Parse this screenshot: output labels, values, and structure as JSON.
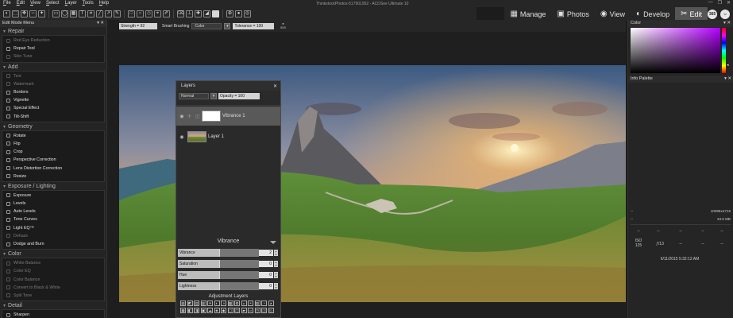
{
  "window": {
    "title": "ThinkstockPhotos-517901952 - ACDSee Ultimate 10",
    "buttons": [
      "—",
      "❐",
      "✕"
    ]
  },
  "menu": [
    "File",
    "Edit",
    "View",
    "Select",
    "Layer",
    "Tools",
    "Help"
  ],
  "toolbar": {
    "icons": [
      "mask-icon",
      "select-icon",
      "move-icon",
      "lasso-icon",
      "magic-wand-icon",
      "rect-select-icon",
      "ellipse-select-icon",
      "brush-select-icon",
      "text-icon",
      "crop-icon",
      "line-icon",
      "arrow-icon",
      "pen-icon",
      "rectangle-icon",
      "circle-icon",
      "shape-icon",
      "dropper-icon",
      "brush-icon",
      "eraser-icon",
      "stamp-icon",
      "heal-icon",
      "fill-icon",
      "gradient-icon",
      "color-swatch-icon",
      "zoom-icon",
      "hand-icon",
      "rotate-icon"
    ]
  },
  "modes": {
    "items": [
      {
        "name": "Manage",
        "icon": "▦"
      },
      {
        "name": "Photos",
        "icon": "▣"
      },
      {
        "name": "View",
        "icon": "◉"
      },
      {
        "name": "Develop",
        "icon": "◐"
      },
      {
        "name": "Edit",
        "icon": "✂"
      }
    ],
    "active": "Edit",
    "round_buttons": [
      "365",
      "☺"
    ]
  },
  "left_panel": {
    "title": "Edit Mode Menu",
    "pin": "▾ ✕",
    "groups": [
      {
        "title": "Repair",
        "items": [
          {
            "label": "Red Eye Reduction",
            "dim": true
          },
          {
            "label": "Repair Tool",
            "dim": false
          },
          {
            "label": "Skin Tune",
            "dim": true
          }
        ]
      },
      {
        "title": "Add",
        "items": [
          {
            "label": "Text",
            "dim": true
          },
          {
            "label": "Watermark",
            "dim": true
          },
          {
            "label": "Borders",
            "dim": false
          },
          {
            "label": "Vignette",
            "dim": false
          },
          {
            "label": "Special Effect",
            "dim": false
          },
          {
            "label": "Tilt-Shift",
            "dim": false
          }
        ]
      },
      {
        "title": "Geometry",
        "items": [
          {
            "label": "Rotate",
            "dim": false
          },
          {
            "label": "Flip",
            "dim": false
          },
          {
            "label": "Crop",
            "dim": false
          },
          {
            "label": "Perspective Correction",
            "dim": false
          },
          {
            "label": "Lens Distortion Correction",
            "dim": false
          },
          {
            "label": "Resize",
            "dim": false
          }
        ]
      },
      {
        "title": "Exposure / Lighting",
        "items": [
          {
            "label": "Exposure",
            "dim": false
          },
          {
            "label": "Levels",
            "dim": false
          },
          {
            "label": "Auto Levels",
            "dim": false
          },
          {
            "label": "Tone Curves",
            "dim": false
          },
          {
            "label": "Light EQ™",
            "dim": false
          },
          {
            "label": "Dehaze",
            "dim": true
          },
          {
            "label": "Dodge and Burn",
            "dim": false
          }
        ]
      },
      {
        "title": "Color",
        "items": [
          {
            "label": "White Balance",
            "dim": true
          },
          {
            "label": "Color EQ",
            "dim": true
          },
          {
            "label": "Color Balance",
            "dim": true
          },
          {
            "label": "Convert to Black & White",
            "dim": true
          },
          {
            "label": "Split Tone",
            "dim": true
          }
        ]
      },
      {
        "title": "Detail",
        "items": [
          {
            "label": "Sharpen",
            "dim": false
          }
        ]
      }
    ]
  },
  "options_bar": {
    "strength": "Strength = 92",
    "mode_label": "Smart Brushing",
    "mode_value": "Color",
    "tolerance": "Tolerance = 100",
    "size": "500"
  },
  "layers_panel": {
    "title": "Layers",
    "close": "✕",
    "blend_mode": "Normal",
    "opacity": "Opacity = 100",
    "layers": [
      {
        "name": "Vibrance 1",
        "selected": true
      },
      {
        "name": "Layer 1",
        "selected": false
      }
    ],
    "adjustment_name": "Vibrance",
    "sliders": [
      {
        "label": "Vibrance",
        "value": "2"
      },
      {
        "label": "Saturation",
        "value": "0"
      },
      {
        "label": "Hue",
        "value": "0"
      },
      {
        "label": "Lightness",
        "value": "0"
      }
    ],
    "adjustment_layers_title": "Adjustment Layers",
    "adjustment_icons": [
      "▧",
      "◩",
      "▤",
      "▥",
      "☀",
      "◐",
      "◑",
      "▦",
      "✿",
      "◒",
      "◓",
      "▨",
      "◔",
      "◕",
      "▩",
      "◧",
      "◨",
      "▣",
      "☁",
      "◈",
      "◆",
      "▢",
      "◫",
      "▰",
      "▱",
      "◳",
      "◲",
      "◱"
    ]
  },
  "right_panel": {
    "color_title": "Color",
    "info_title": "Info Palette",
    "pin": "▾ ✕",
    "dimensions": "10096x4716",
    "filesize": "33.8 MB",
    "dash": "--",
    "iso": "ISO 125",
    "aperture": "ƒ/13",
    "date": "6/11/2015 5:32:12 AM"
  },
  "colors": {
    "accent": "#595959",
    "picker_hue": "#b300ff"
  }
}
